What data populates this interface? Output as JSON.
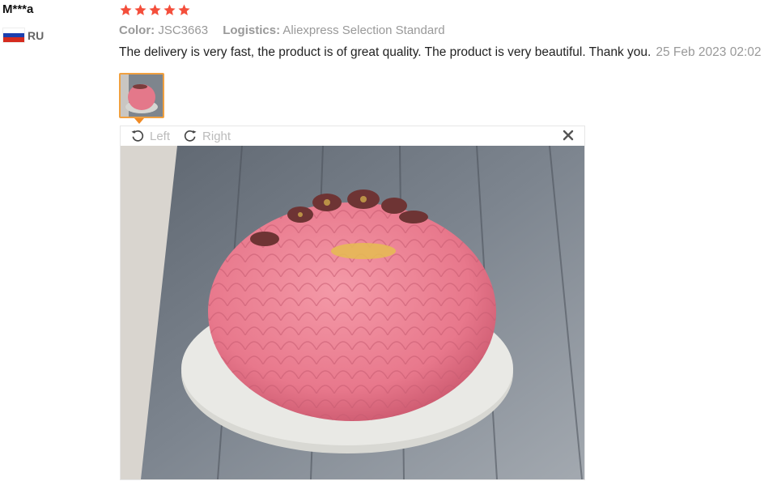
{
  "user": {
    "name": "M***a",
    "country_code": "RU"
  },
  "review": {
    "rating": 5,
    "color_label": "Color:",
    "color_value": "JSC3663",
    "logistics_label": "Logistics:",
    "logistics_value": "Aliexpress Selection Standard",
    "text": "The delivery is very fast, the product is of great quality. The product is very beautiful. Thank you.",
    "date": "25 Feb 2023 02:02"
  },
  "viewer": {
    "rotate_left_label": "Left",
    "rotate_right_label": "Right"
  },
  "colors": {
    "star": "#f44e3b",
    "thumb_border": "#f0a040",
    "meta": "#999999"
  }
}
